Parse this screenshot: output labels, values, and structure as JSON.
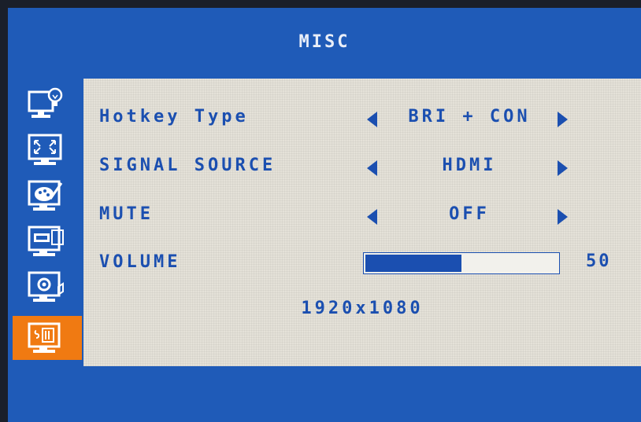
{
  "title": "MISC",
  "sidebar": {
    "items": [
      {
        "icon": "brightness-bulb-icon",
        "active": false
      },
      {
        "icon": "image-size-icon",
        "active": false
      },
      {
        "icon": "color-palette-icon",
        "active": false
      },
      {
        "icon": "osd-settings-icon",
        "active": false
      },
      {
        "icon": "setup-gear-icon",
        "active": false
      },
      {
        "icon": "misc-settings-icon",
        "active": true
      }
    ]
  },
  "settings": {
    "hotkey_type": {
      "label": "Hotkey Type",
      "value": "BRI + CON"
    },
    "signal_source": {
      "label": "SIGNAL SOURCE",
      "value": "HDMI"
    },
    "mute": {
      "label": "MUTE",
      "value": "OFF"
    },
    "volume": {
      "label": "VOLUME",
      "value": "50",
      "level": 50
    }
  },
  "resolution": "1920x1080",
  "colors": {
    "frame": "#1f5bb8",
    "panel": "#e4e1d8",
    "text": "#1b4fb0",
    "active_tab": "#f07a12"
  }
}
